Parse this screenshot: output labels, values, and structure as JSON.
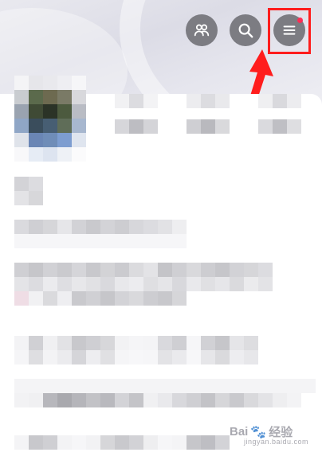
{
  "header": {
    "buttons": [
      {
        "name": "friends-button",
        "icon": "people-icon"
      },
      {
        "name": "search-button",
        "icon": "search-icon"
      },
      {
        "name": "menu-button",
        "icon": "hamburger-menu-icon",
        "has_notification_dot": true
      }
    ],
    "colors": {
      "button_bg": "#7c7c82",
      "notification_dot": "#ff2d55",
      "highlight": "#ff1d1d"
    }
  },
  "annotation": {
    "highlight_target": "menu-button",
    "arrow": "arrow-pointing-up-right"
  },
  "content": {
    "note": "",
    "blurred": true
  },
  "watermark": {
    "text": "Bai",
    "text2": "经验",
    "sub": "jingyan.baidu.com"
  }
}
